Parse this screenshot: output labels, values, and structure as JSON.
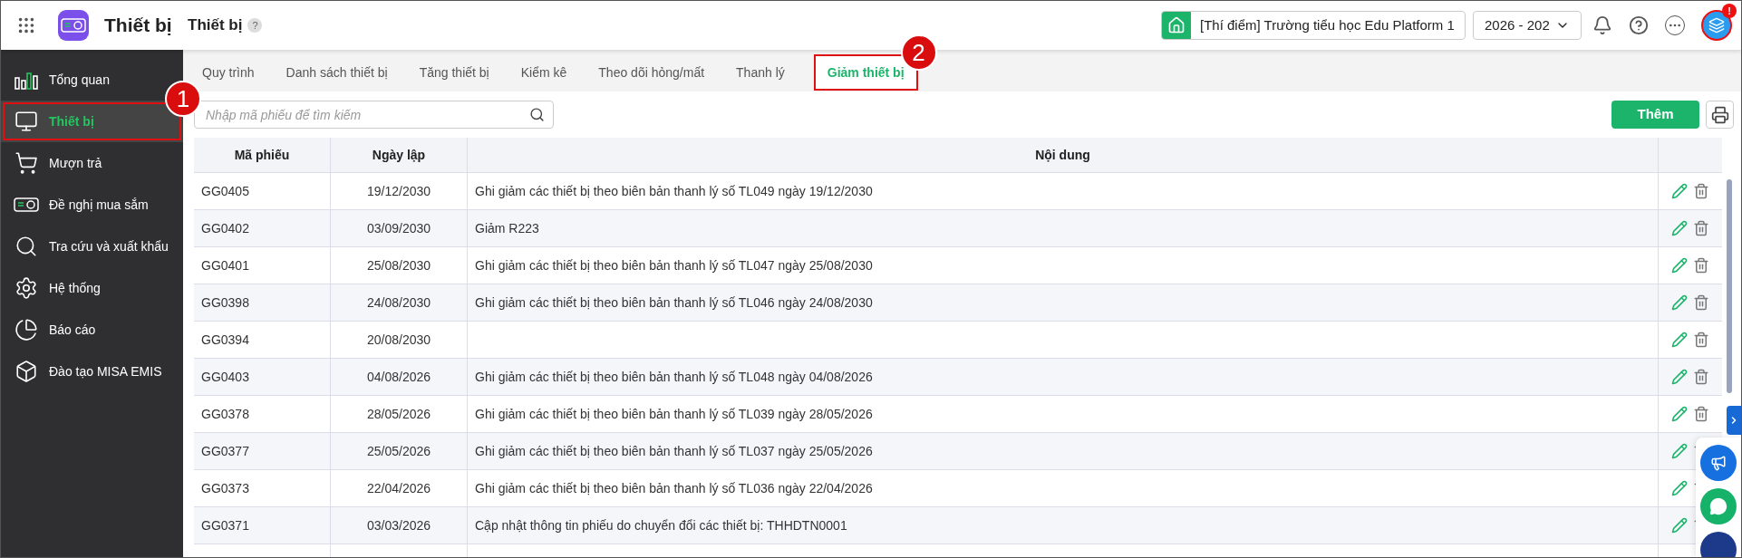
{
  "app": {
    "title": "Thiết bị",
    "page_title": "Thiết bị",
    "help_mark": "?"
  },
  "header": {
    "school": "[Thí điểm] Trường tiểu học Edu Platform 1",
    "year": "2026 - 202",
    "avatar_badge": "!"
  },
  "sidebar": {
    "items": [
      {
        "label": "Tổng quan",
        "selected": false
      },
      {
        "label": "Thiết bị",
        "selected": true,
        "callout": "1"
      },
      {
        "label": "Mượn trả",
        "selected": false
      },
      {
        "label": "Đề nghị mua sắm",
        "selected": false
      },
      {
        "label": "Tra cứu và xuất khẩu",
        "selected": false
      },
      {
        "label": "Hệ thống",
        "selected": false
      },
      {
        "label": "Báo cáo",
        "selected": false
      },
      {
        "label": "Đào tạo MISA EMIS",
        "selected": false
      }
    ]
  },
  "tabs": [
    {
      "label": "Quy trình",
      "selected": false
    },
    {
      "label": "Danh sách thiết bị",
      "selected": false
    },
    {
      "label": "Tăng thiết bị",
      "selected": false
    },
    {
      "label": "Kiểm kê",
      "selected": false
    },
    {
      "label": "Theo dõi hỏng/mất",
      "selected": false
    },
    {
      "label": "Thanh lý",
      "selected": false
    },
    {
      "label": "Giảm thiết bị",
      "selected": true,
      "callout": "2"
    }
  ],
  "search": {
    "placeholder": "Nhập mã phiếu để tìm kiếm"
  },
  "add_button": "Thêm",
  "table": {
    "columns": [
      "Mã phiếu",
      "Ngày lập",
      "Nội dung"
    ],
    "rows": [
      {
        "code": "GG0405",
        "date": "19/12/2030",
        "content": "Ghi giảm các thiết bị theo biên bản thanh lý số TL049 ngày 19/12/2030"
      },
      {
        "code": "GG0402",
        "date": "03/09/2030",
        "content": "Giảm R223"
      },
      {
        "code": "GG0401",
        "date": "25/08/2030",
        "content": "Ghi giảm các thiết bị theo biên bản thanh lý số TL047 ngày 25/08/2030"
      },
      {
        "code": "GG0398",
        "date": "24/08/2030",
        "content": "Ghi giảm các thiết bị theo biên bản thanh lý số TL046 ngày 24/08/2030"
      },
      {
        "code": "GG0394",
        "date": "20/08/2030"
      },
      {
        "code": "GG0403",
        "date": "04/08/2026",
        "content": "Ghi giảm các thiết bị theo biên bản thanh lý số TL048 ngày 04/08/2026"
      },
      {
        "code": "GG0378",
        "date": "28/05/2026",
        "content": "Ghi giảm các thiết bị theo biên bản thanh lý số TL039 ngày 28/05/2026"
      },
      {
        "code": "GG0377",
        "date": "25/05/2026",
        "content": "Ghi giảm các thiết bị theo biên bản thanh lý số TL037 ngày 25/05/2026"
      },
      {
        "code": "GG0373",
        "date": "22/04/2026",
        "content": "Ghi giảm các thiết bị theo biên bản thanh lý số TL036 ngày 22/04/2026"
      },
      {
        "code": "GG0371",
        "date": "03/03/2026",
        "content": "Cập nhật thông tin phiếu do chuyển đổi các thiết bị: THHDTN0001"
      }
    ]
  }
}
